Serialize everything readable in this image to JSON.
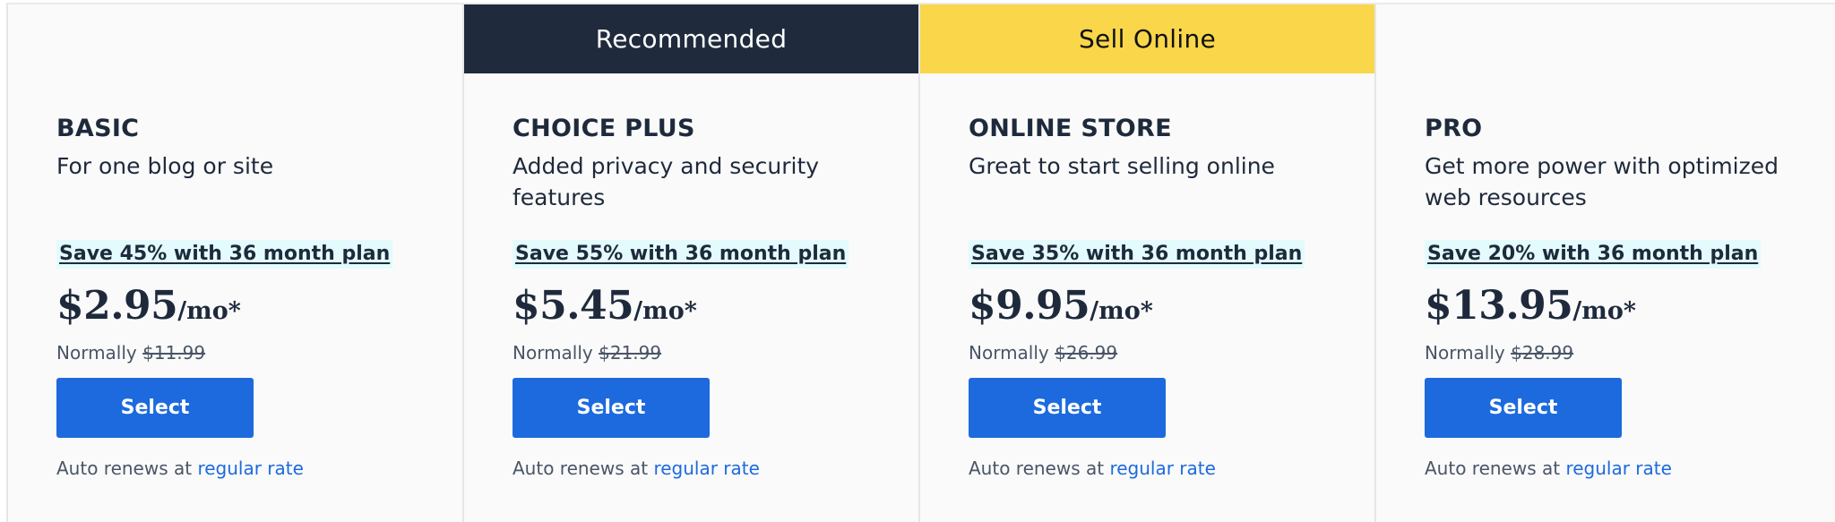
{
  "colors": {
    "recommended_banner": "#1f2a3d",
    "sell_online_banner": "#f9d64a",
    "select_button": "#1c6ade",
    "save_highlight": "#e3fbfc",
    "link": "#1c6ade",
    "text": "#1e2a3c"
  },
  "plans": [
    {
      "banner": null,
      "name": "BASIC",
      "description": "For one blog or site",
      "save": "Save 45% with 36 month plan",
      "price": "$2.95",
      "per": "/mo*",
      "normally_label": "Normally",
      "normally_price": "$11.99",
      "select_label": "Select",
      "renew_text": "Auto renews at",
      "renew_link": "regular rate"
    },
    {
      "banner": "Recommended",
      "name": "CHOICE PLUS",
      "description": "Added privacy and security features",
      "save": "Save 55% with 36 month plan",
      "price": "$5.45",
      "per": "/mo*",
      "normally_label": "Normally",
      "normally_price": "$21.99",
      "select_label": "Select",
      "renew_text": "Auto renews at",
      "renew_link": "regular rate"
    },
    {
      "banner": "Sell Online",
      "name": "ONLINE STORE",
      "description": "Great to start selling online",
      "save": "Save 35% with 36 month plan",
      "price": "$9.95",
      "per": "/mo*",
      "normally_label": "Normally",
      "normally_price": "$26.99",
      "select_label": "Select",
      "renew_text": "Auto renews at",
      "renew_link": "regular rate"
    },
    {
      "banner": null,
      "name": "PRO",
      "description": "Get more power with optimized web resources",
      "save": "Save 20% with 36 month plan",
      "price": "$13.95",
      "per": "/mo*",
      "normally_label": "Normally",
      "normally_price": "$28.99",
      "select_label": "Select",
      "renew_text": "Auto renews at",
      "renew_link": "regular rate"
    }
  ]
}
